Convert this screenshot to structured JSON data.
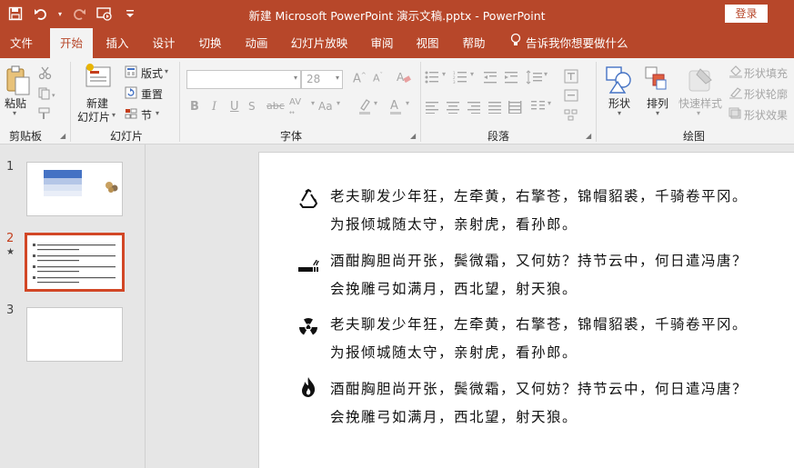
{
  "titlebar": {
    "title": "新建 Microsoft PowerPoint 演示文稿.pptx  -  PowerPoint",
    "login_label": "登录",
    "qat_icons": [
      "save-icon",
      "undo-icon",
      "redo-icon",
      "start-from-beginning-icon",
      "customize-qat-icon"
    ]
  },
  "tabs": [
    {
      "label": "文件"
    },
    {
      "label": "开始",
      "active": true
    },
    {
      "label": "插入"
    },
    {
      "label": "设计"
    },
    {
      "label": "切换"
    },
    {
      "label": "动画"
    },
    {
      "label": "幻灯片放映"
    },
    {
      "label": "审阅"
    },
    {
      "label": "视图"
    },
    {
      "label": "帮助"
    }
  ],
  "tell_me": "告诉我你想要做什么",
  "ribbon": {
    "clipboard": {
      "paste_label": "粘贴",
      "group_label": "剪贴板"
    },
    "slides": {
      "new_slide_label_1": "新建",
      "new_slide_label_2": "幻灯片",
      "layout_label": "版式",
      "reset_label": "重置",
      "section_label": "节",
      "group_label": "幻灯片"
    },
    "font": {
      "font_name_value": "",
      "font_size_value": "28",
      "group_label": "字体"
    },
    "paragraph": {
      "group_label": "段落"
    },
    "drawing": {
      "shapes_label": "形状",
      "arrange_label": "排列",
      "quick_styles_label": "快速样式",
      "shape_fill_label": "形状填充",
      "shape_outline_label": "形状轮廓",
      "shape_effects_label": "形状效果",
      "group_label": "绘图"
    }
  },
  "slides_panel": [
    {
      "number": "1"
    },
    {
      "number": "2",
      "current": true
    },
    {
      "number": "3"
    }
  ],
  "slide_content": {
    "items": [
      {
        "icon": "recycle-icon",
        "line1": "老夫聊发少年狂，左牵黄，右擎苍，锦帽貂裘，千骑卷平冈。",
        "line2": "为报倾城随太守，亲射虎，看孙郎。"
      },
      {
        "icon": "no-smoking-icon",
        "line1": "酒酣胸胆尚开张，鬓微霜，又何妨？持节云中，何日遣冯唐？",
        "line2": "会挽雕弓如满月，西北望，射天狼。"
      },
      {
        "icon": "radiation-icon",
        "line1": "老夫聊发少年狂，左牵黄，右擎苍，锦帽貂裘，千骑卷平冈。",
        "line2": "为报倾城随太守，亲射虎，看孙郎。"
      },
      {
        "icon": "flame-icon",
        "line1": "酒酣胸胆尚开张，鬓微霜，又何妨？持节云中，何日遣冯唐？",
        "line2": "会挽雕弓如满月，西北望，射天狼。"
      }
    ]
  },
  "colors": {
    "accent": "#b7472a",
    "selection": "#d24726",
    "ribbon_bg": "#f3f3f3"
  }
}
